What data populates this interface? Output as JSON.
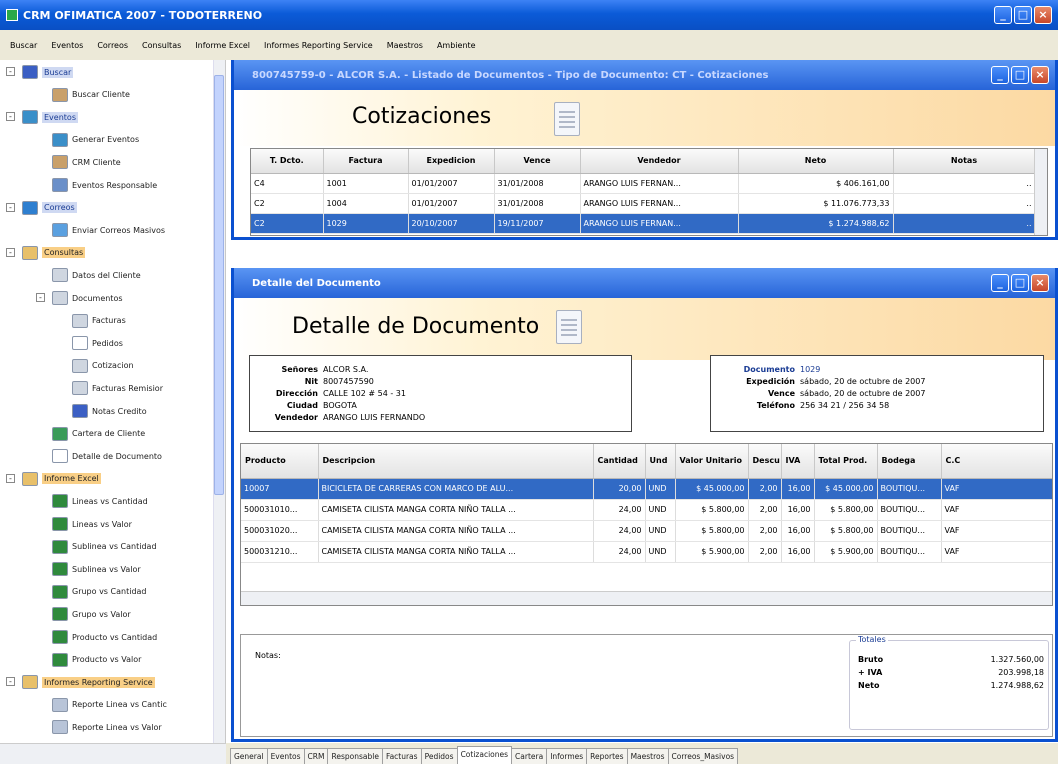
{
  "app": {
    "title": "CRM OFIMATICA 2007 - TODOTERRENO"
  },
  "window_buttons": {
    "minimize": "_",
    "maximize": "□",
    "close": "×"
  },
  "menu": [
    "Buscar",
    "Eventos",
    "Correos",
    "Consultas",
    "Informe Excel",
    "Informes Reporting Service",
    "Maestros",
    "Ambiente"
  ],
  "tree": [
    {
      "label": "Buscar",
      "level": 0,
      "style": "hlb",
      "icon": "binoculars-icon",
      "color": "#3b5fc4",
      "exp": "-"
    },
    {
      "label": "Buscar Cliente",
      "level": 1,
      "icon": "person-icon",
      "color": "#c9a06a"
    },
    {
      "label": "Eventos",
      "level": 0,
      "style": "hlb",
      "icon": "calendar-icon",
      "color": "#3a8fc9",
      "exp": "-"
    },
    {
      "label": "Generar Eventos",
      "level": 1,
      "icon": "calendar-icon",
      "color": "#3a8fc9"
    },
    {
      "label": "CRM Cliente",
      "level": 1,
      "icon": "person-icon",
      "color": "#c9a06a"
    },
    {
      "label": "Eventos Responsable",
      "level": 1,
      "icon": "people-icon",
      "color": "#6a8fc9"
    },
    {
      "label": "Correos",
      "level": 0,
      "style": "hlb",
      "icon": "globe-icon",
      "color": "#2e7fd0",
      "exp": "-"
    },
    {
      "label": "Enviar Correos Masivos",
      "level": 1,
      "icon": "mail-icon",
      "color": "#5aa0e0"
    },
    {
      "label": "Consultas",
      "level": 0,
      "style": "hl",
      "icon": "folder-icon",
      "color": "#e8c06a",
      "exp": "-"
    },
    {
      "label": "Datos del Cliente",
      "level": 1,
      "icon": "document-icon",
      "color": "#cfd6e0"
    },
    {
      "label": "Documentos",
      "level": 1,
      "icon": "documents-icon",
      "color": "#cfd6e0",
      "exp": "-"
    },
    {
      "label": "Facturas",
      "level": 2,
      "icon": "document-icon",
      "color": "#cfd6e0"
    },
    {
      "label": "Pedidos",
      "level": 2,
      "icon": "document-icon",
      "color": "#ffffff"
    },
    {
      "label": "Cotizacion",
      "level": 2,
      "icon": "document-icon",
      "color": "#cfd6e0"
    },
    {
      "label": "Facturas Remisior",
      "level": 2,
      "icon": "document-icon",
      "color": "#cfd6e0"
    },
    {
      "label": "Notas Credito",
      "level": 2,
      "icon": "binoculars-icon",
      "color": "#3b5fc4"
    },
    {
      "label": "Cartera de Cliente",
      "level": 1,
      "icon": "money-icon",
      "color": "#3a9b5a"
    },
    {
      "label": "Detalle de Documento",
      "level": 1,
      "icon": "document-icon",
      "color": "#ffffff"
    },
    {
      "label": "Informe Excel",
      "level": 0,
      "style": "hl",
      "icon": "folder-icon",
      "color": "#e8c06a",
      "exp": "-"
    },
    {
      "label": "Lineas vs Cantidad",
      "level": 1,
      "icon": "excel-icon",
      "color": "#2f8a3d"
    },
    {
      "label": "Lineas vs Valor",
      "level": 1,
      "icon": "excel-icon",
      "color": "#2f8a3d"
    },
    {
      "label": "Sublinea vs Cantidad",
      "level": 1,
      "icon": "excel-icon",
      "color": "#2f8a3d"
    },
    {
      "label": "Sublinea vs Valor",
      "level": 1,
      "icon": "excel-icon",
      "color": "#2f8a3d"
    },
    {
      "label": "Grupo vs Cantidad",
      "level": 1,
      "icon": "excel-icon",
      "color": "#2f8a3d"
    },
    {
      "label": "Grupo vs Valor",
      "level": 1,
      "icon": "excel-icon",
      "color": "#2f8a3d"
    },
    {
      "label": "Producto vs Cantidad",
      "level": 1,
      "icon": "excel-icon",
      "color": "#2f8a3d"
    },
    {
      "label": "Producto vs Valor",
      "level": 1,
      "icon": "excel-icon",
      "color": "#2f8a3d"
    },
    {
      "label": "Informes Reporting Service",
      "level": 0,
      "style": "hl",
      "icon": "folder-icon",
      "color": "#e8c06a",
      "exp": "-"
    },
    {
      "label": "Reporte Linea vs Cantic",
      "level": 1,
      "icon": "report-icon",
      "color": "#b8c4d8"
    },
    {
      "label": "Reporte Linea vs Valor",
      "level": 1,
      "icon": "report-icon",
      "color": "#b8c4d8"
    }
  ],
  "docwin": {
    "title": "800745759-0 - ALCOR S.A. - Listado de Documentos - Tipo de Documento: CT - Cotizaciones",
    "banner": "Cotizaciones",
    "columns": [
      "T. Dcto.",
      "Factura",
      "Expedicion",
      "Vence",
      "Vendedor",
      "Neto",
      "Notas"
    ],
    "rows": [
      [
        "C4",
        "1001",
        "01/01/2007",
        "31/01/2008",
        "ARANGO LUIS FERNAN...",
        "$ 406.161,00",
        ".."
      ],
      [
        "C2",
        "1004",
        "01/01/2007",
        "31/01/2008",
        "ARANGO LUIS FERNAN...",
        "$ 11.076.773,33",
        ".."
      ],
      [
        "C2",
        "1029",
        "20/10/2007",
        "19/11/2007",
        "ARANGO LUIS FERNAN...",
        "$ 1.274.988,62",
        ".."
      ]
    ],
    "selected": 2
  },
  "detwin": {
    "title": "Detalle del Documento",
    "banner": "Detalle de Documento",
    "client": [
      {
        "k": "Señores",
        "v": "ALCOR S.A."
      },
      {
        "k": "Nit",
        "v": "8007457590"
      },
      {
        "k": "Dirección",
        "v": "CALLE 102 # 54 - 31"
      },
      {
        "k": "Ciudad",
        "v": "BOGOTA"
      },
      {
        "k": "Vendedor",
        "v": "ARANGO LUIS FERNANDO"
      }
    ],
    "doc": [
      {
        "k": "Documento",
        "v": "1029"
      },
      {
        "k": "Expedición",
        "v": "sábado, 20 de octubre de 2007"
      },
      {
        "k": "Vence",
        "v": "sábado, 20 de octubre de 2007"
      },
      {
        "k": "Teléfono",
        "v": "256 34 21 / 256 34 58"
      }
    ],
    "columns": [
      "Producto",
      "Descripcion",
      "Cantidad",
      "Und",
      "Valor Unitario",
      "Descu",
      "IVA",
      "Total Prod.",
      "Bodega",
      "C.C"
    ],
    "rows": [
      [
        "10007",
        "BICICLETA DE CARRERAS CON MARCO DE ALU...",
        "20,00",
        "UND",
        "$ 45.000,00",
        "2,00",
        "16,00",
        "$ 45.000,00",
        "BOUTIQU...",
        "VAF"
      ],
      [
        "500031010...",
        "CAMISETA CILISTA MANGA CORTA NIÑO TALLA ...",
        "24,00",
        "UND",
        "$ 5.800,00",
        "2,00",
        "16,00",
        "$ 5.800,00",
        "BOUTIQU...",
        "VAF"
      ],
      [
        "500031020...",
        "CAMISETA CILISTA MANGA CORTA NIÑO TALLA ...",
        "24,00",
        "UND",
        "$ 5.800,00",
        "2,00",
        "16,00",
        "$ 5.800,00",
        "BOUTIQU...",
        "VAF"
      ],
      [
        "500031210...",
        "CAMISETA CILISTA MANGA CORTA NIÑO TALLA ...",
        "24,00",
        "UND",
        "$ 5.900,00",
        "2,00",
        "16,00",
        "$ 5.900,00",
        "BOUTIQU...",
        "VAF"
      ]
    ],
    "selected": 0,
    "notes_label": "Notas:",
    "totals_label": "Totales",
    "totals": [
      {
        "k": "Bruto",
        "v": "1.327.560,00"
      },
      {
        "k": "+ IVA",
        "v": "203.998,18"
      },
      {
        "k": "Neto",
        "v": "1.274.988,62"
      }
    ]
  },
  "tabs": [
    "General",
    "Eventos",
    "CRM",
    "Responsable",
    "Facturas",
    "Pedidos",
    "Cotizaciones",
    "Cartera",
    "Informes",
    "Reportes",
    "Maestros",
    "Correos_Masivos"
  ],
  "active_tab": "Cotizaciones",
  "colors": {
    "titlebar": "#0b5bd8",
    "selection": "#316ac5",
    "highlight": "#f9cf86"
  }
}
